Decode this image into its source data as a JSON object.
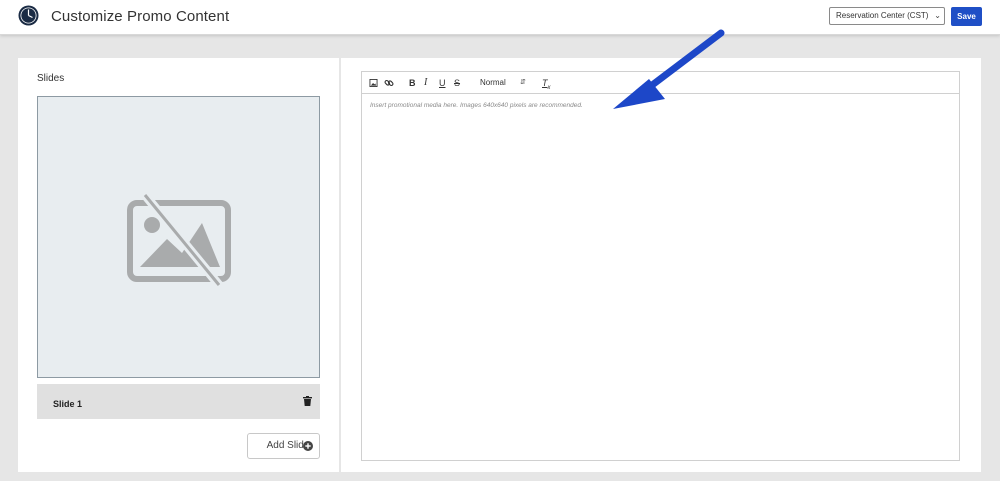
{
  "header": {
    "title": "Customize Promo Content",
    "location_select": {
      "value": "Reservation Center (CST)"
    },
    "save_label": "Save"
  },
  "slides_panel": {
    "heading": "Slides",
    "slides": [
      {
        "label": "Slide 1"
      }
    ],
    "add_slide_label": "Add Slide"
  },
  "editor": {
    "toolbar": {
      "image": "image-icon",
      "link": "link-icon",
      "bold": "B",
      "italic": "I",
      "underline": "U",
      "strike": "S",
      "format_value": "Normal",
      "clear": "T"
    },
    "placeholder": "Insert promotional media here. Images 640x640 pixels are recommended."
  },
  "colors": {
    "accent": "#1f4fc6",
    "arrow": "#1d47c8",
    "placeholder_bg": "#e8edf0"
  }
}
